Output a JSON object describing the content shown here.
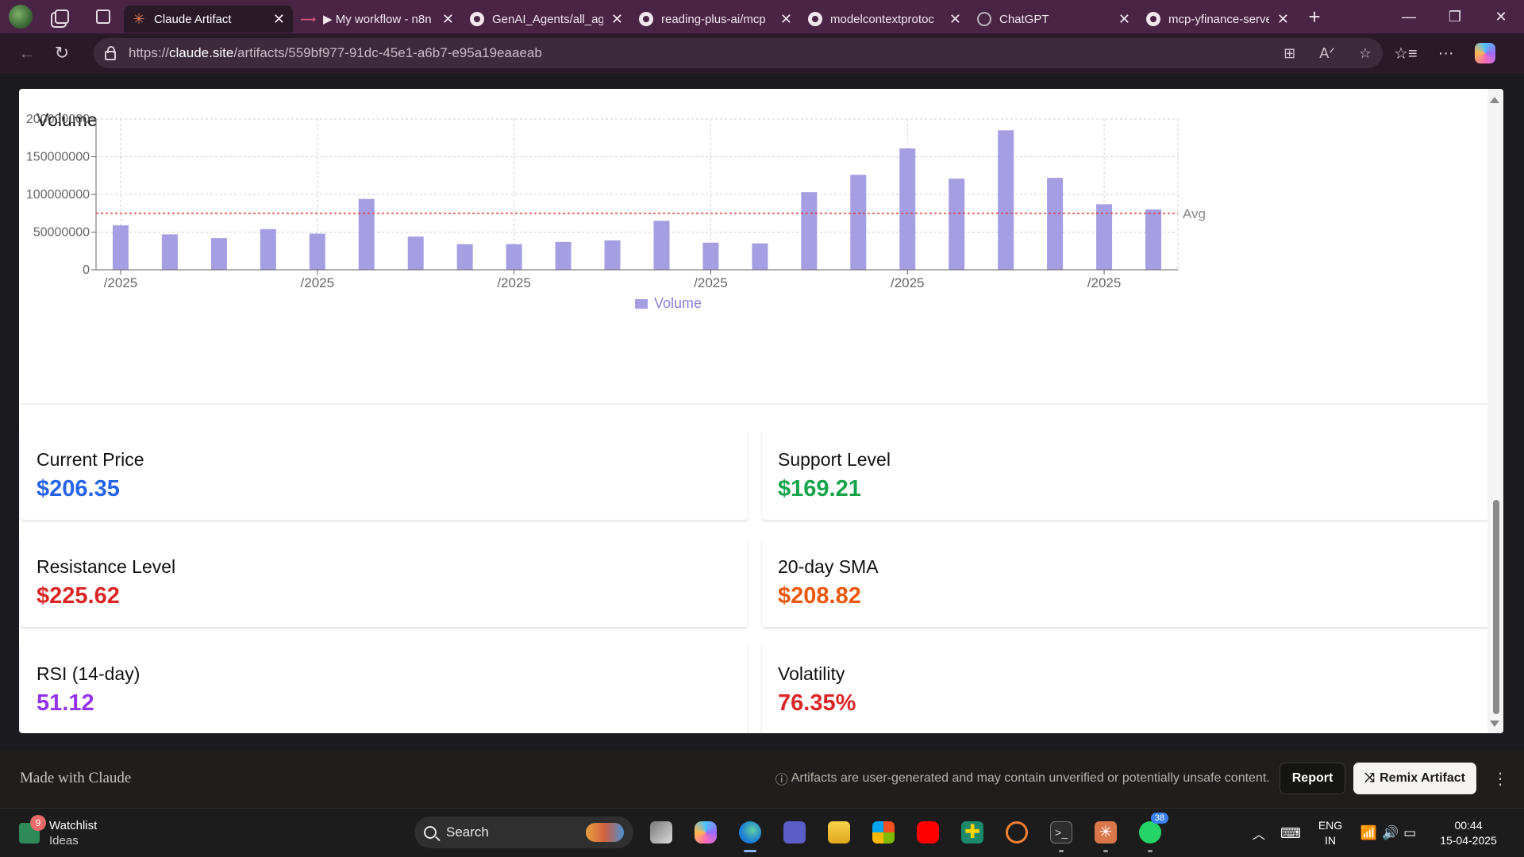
{
  "browser": {
    "tabs": [
      {
        "title": "Claude Artifact",
        "icon": "claude-icon",
        "active": true
      },
      {
        "title": "My workflow - n8n",
        "icon": "n8n-icon",
        "active": false
      },
      {
        "title": "GenAI_Agents/all_ag",
        "icon": "github-icon",
        "active": false
      },
      {
        "title": "reading-plus-ai/mcp",
        "icon": "github-icon",
        "active": false
      },
      {
        "title": "modelcontextprotoc",
        "icon": "github-icon",
        "active": false
      },
      {
        "title": "ChatGPT",
        "icon": "chatgpt-icon",
        "active": false
      },
      {
        "title": "mcp-yfinance-server",
        "icon": "github-icon",
        "active": false
      }
    ],
    "address": {
      "prefix": "https://",
      "host": "claude.site",
      "path": "/artifacts/559bf977-91dc-45e1-a6b7-e95a19eaaeab"
    }
  },
  "volume_chart": {
    "title": "Volume",
    "legend": "Volume",
    "avg_label": "Avg",
    "y_ticks": [
      "0",
      "50000000",
      "100000000",
      "150000000",
      "200000000"
    ],
    "x_tick_label": "/2025",
    "colors": {
      "bar": "#a59ee3",
      "avg": "#e53935",
      "grid": "#cfcfcf"
    }
  },
  "chart_data": {
    "type": "bar",
    "title": "Volume",
    "series": [
      {
        "name": "Volume",
        "values": [
          59000000,
          47000000,
          42000000,
          54000000,
          48000000,
          94000000,
          44000000,
          34000000,
          34000000,
          37000000,
          39000000,
          65000000,
          36000000,
          35000000,
          103000000,
          126000000,
          161000000,
          121000000,
          185000000,
          122000000,
          87000000,
          80000000
        ]
      }
    ],
    "reference_line": {
      "label": "Avg",
      "value": 75000000
    },
    "x_tick_labels": [
      "/2025",
      "/2025",
      "/2025",
      "/2025",
      "/2025",
      "/2025"
    ],
    "x_tick_indices": [
      0,
      4,
      8,
      12,
      16,
      20
    ],
    "ylim": [
      0,
      200000000
    ],
    "grid": true,
    "legend_position": "bottom-center"
  },
  "stats": {
    "current_price": {
      "label": "Current Price",
      "value": "$206.35"
    },
    "support": {
      "label": "Support Level",
      "value": "$169.21"
    },
    "resistance": {
      "label": "Resistance Level",
      "value": "$225.62"
    },
    "sma20": {
      "label": "20-day SMA",
      "value": "$208.82"
    },
    "rsi": {
      "label": "RSI (14-day)",
      "value": "51.12"
    },
    "volatility": {
      "label": "Volatility",
      "value": "76.35%"
    }
  },
  "footer": {
    "made_with": "Made with Claude",
    "notice": "Artifacts are user-generated and may contain unverified or potentially unsafe content.",
    "report": "Report",
    "remix": "Remix Artifact"
  },
  "taskbar": {
    "widget_title": "Watchlist",
    "widget_sub": "Ideas",
    "widget_badge": "9",
    "search_label": "Search",
    "whatsapp_badge": "38",
    "lang_top": "ENG",
    "lang_bottom": "IN",
    "time": "00:44",
    "date": "15-04-2025"
  }
}
